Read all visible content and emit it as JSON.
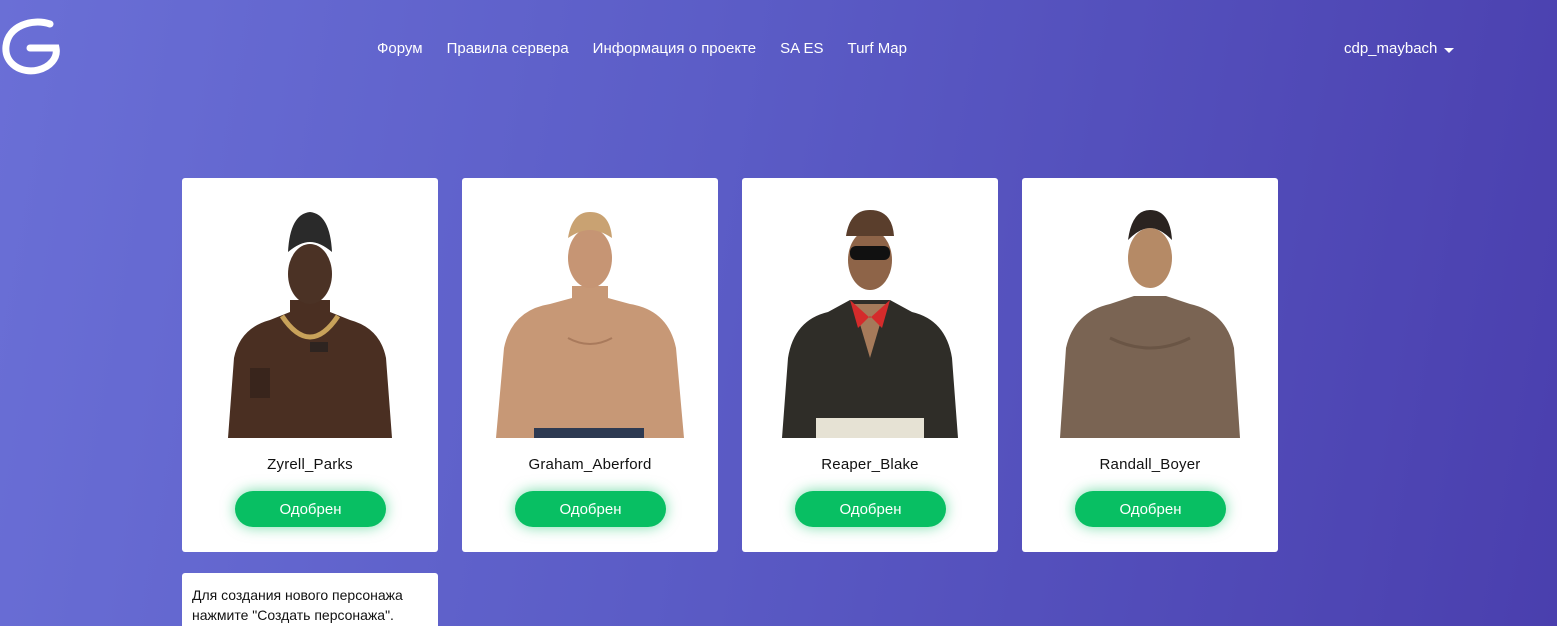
{
  "nav": {
    "items": [
      {
        "label": "Форум"
      },
      {
        "label": "Правила сервера"
      },
      {
        "label": "Информация о проекте"
      },
      {
        "label": "SA ES"
      },
      {
        "label": "Turf Map"
      }
    ]
  },
  "user": {
    "name": "cdp_maybach",
    "menu_icon": "caret-down-icon"
  },
  "logo": {
    "icon": "logo-icon"
  },
  "characters": [
    {
      "name": "Zyrell_Parks",
      "status": "Одобрен"
    },
    {
      "name": "Graham_Aberford",
      "status": "Одобрен"
    },
    {
      "name": "Reaper_Blake",
      "status": "Одобрен"
    },
    {
      "name": "Randall_Boyer",
      "status": "Одобрен"
    }
  ],
  "hint": {
    "text": "Для создания нового персонажа нажмите \"Создать персонажа\"."
  },
  "colors": {
    "background_start": "#6a6fd6",
    "background_end": "#4a3fae",
    "status_green": "#08bf63"
  }
}
